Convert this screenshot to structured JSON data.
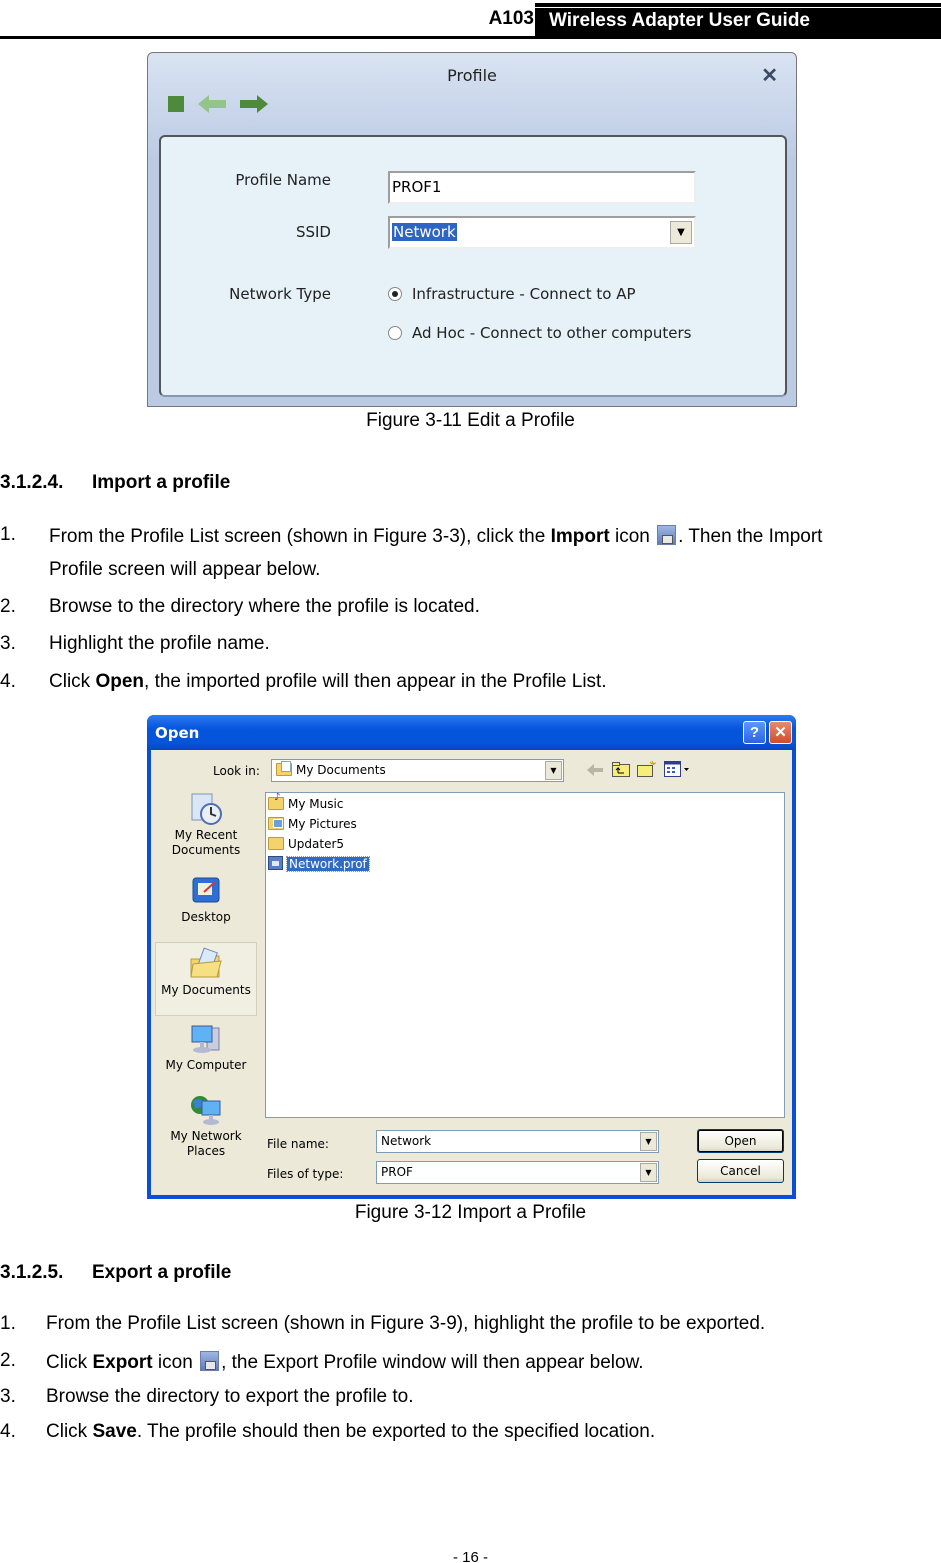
{
  "header": {
    "model": "A103",
    "title": "Wireless Adapter User Guide"
  },
  "figure_3_11": {
    "window_title": "Profile",
    "toolbar": {
      "stop_icon": "stop-square-icon",
      "back_icon": "arrow-left-icon",
      "forward_icon": "arrow-right-icon"
    },
    "fields": {
      "profile_name_label": "Profile Name",
      "profile_name_value": "PROF1",
      "ssid_label": "SSID",
      "ssid_value": "Network",
      "network_type_label": "Network Type",
      "radio_infrastructure": "Infrastructure - Connect to AP",
      "radio_adhoc": "Ad Hoc - Connect to other computers",
      "selected_network_type": "Infrastructure - Connect to AP"
    },
    "caption": "Figure 3-11 Edit a Profile"
  },
  "section_import": {
    "number": "3.1.2.4.",
    "title": "Import a profile",
    "steps": [
      {
        "n": "1.",
        "pre": "From the Profile List screen (shown in Figure 3-3), click the ",
        "bold": "Import",
        "post": " icon",
        "post2": ". Then the Import",
        "line2": "Profile screen will appear below."
      },
      {
        "n": "2.",
        "text": "Browse to the directory where the profile is located."
      },
      {
        "n": "3.",
        "text": "Highlight the profile name."
      },
      {
        "n": "4.",
        "pre": "Click ",
        "bold": "Open",
        "post": ", the imported profile will then appear in the Profile List."
      }
    ]
  },
  "figure_3_12": {
    "window_title": "Open",
    "help_button": "?",
    "close_button": "✕",
    "look_in_label": "Look in:",
    "look_in_value": "My Documents",
    "places": [
      {
        "label_line1": "My Recent",
        "label_line2": "Documents",
        "icon": "recent-documents-icon"
      },
      {
        "label_line1": "Desktop",
        "label_line2": "",
        "icon": "desktop-icon"
      },
      {
        "label_line1": "My Documents",
        "label_line2": "",
        "icon": "my-documents-icon"
      },
      {
        "label_line1": "My Computer",
        "label_line2": "",
        "icon": "my-computer-icon"
      },
      {
        "label_line1": "My Network",
        "label_line2": "Places",
        "icon": "network-places-icon"
      }
    ],
    "files": [
      {
        "name": "My Music",
        "type": "folder-music"
      },
      {
        "name": "My Pictures",
        "type": "folder-pictures"
      },
      {
        "name": "Updater5",
        "type": "folder"
      },
      {
        "name": "Network.prof",
        "type": "file",
        "selected": true
      }
    ],
    "file_name_label": "File name:",
    "file_name_value": "Network",
    "file_type_label": "Files of type:",
    "file_type_value": "PROF",
    "open_button": "Open",
    "cancel_button": "Cancel",
    "caption": "Figure 3-12 Import a Profile"
  },
  "section_export": {
    "number": "3.1.2.5.",
    "title": "Export a profile",
    "steps": [
      {
        "n": "1.",
        "text": "From the Profile List screen (shown in Figure 3-9), highlight the profile to be exported."
      },
      {
        "n": "2.",
        "pre": "Click ",
        "bold": "Export",
        "post": " icon",
        "post2": ", the Export Profile window will then appear below."
      },
      {
        "n": "3.",
        "text": "Browse the directory to export the profile to."
      },
      {
        "n": "4.",
        "pre": "Click ",
        "bold": "Save",
        "post": ". The profile should then be exported to the specified location."
      }
    ]
  },
  "footer": {
    "page_number": "- 16 -"
  }
}
